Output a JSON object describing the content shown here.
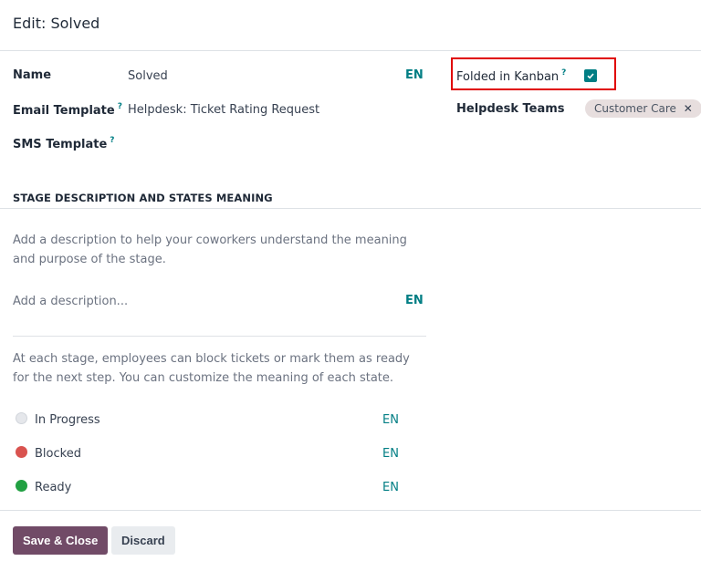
{
  "dialog": {
    "title": "Edit: Solved"
  },
  "fields": {
    "name": {
      "label": "Name",
      "value": "Solved",
      "lang": "EN"
    },
    "email_template": {
      "label": "Email Template",
      "help": "?",
      "value": "Helpdesk: Ticket Rating Request"
    },
    "sms_template": {
      "label": "SMS Template",
      "help": "?",
      "value": ""
    },
    "folded_in_kanban": {
      "label": "Folded in Kanban",
      "help": "?",
      "checked": true
    },
    "helpdesk_teams": {
      "label": "Helpdesk Teams",
      "tags": [
        "Customer Care"
      ],
      "remove_glyph": "✕"
    }
  },
  "section": {
    "title": "STAGE DESCRIPTION AND STATES MEANING",
    "description_help": "Add a description to help your coworkers understand the meaning and purpose of the stage.",
    "description_placeholder": "Add a description...",
    "description_lang": "EN",
    "states_help": "At each stage, employees can block tickets or mark them as ready for the next step. You can customize the meaning of each state.",
    "states": [
      {
        "label": "In Progress",
        "color": "#d1d5db",
        "lang": "EN"
      },
      {
        "label": "Blocked",
        "color": "#d9534f",
        "lang": "EN"
      },
      {
        "label": "Ready",
        "color": "#21a042",
        "lang": "EN"
      }
    ]
  },
  "footer": {
    "save_label": "Save & Close",
    "discard_label": "Discard"
  }
}
